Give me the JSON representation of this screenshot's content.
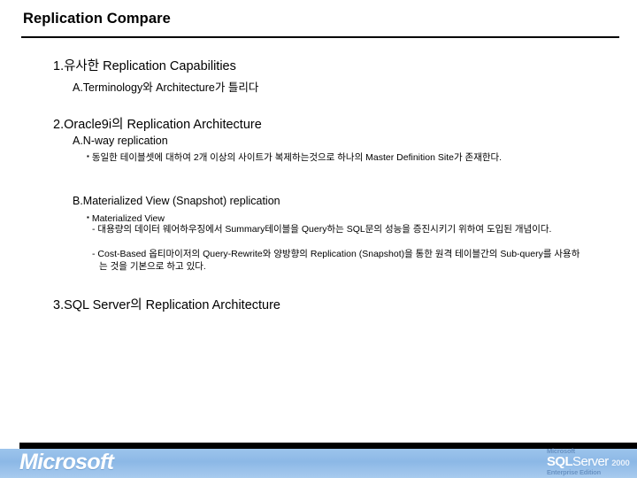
{
  "slide": {
    "title": "Replication Compare",
    "outline": [
      {
        "id": "item1",
        "text": "1.유사한 Replication Capabilities"
      },
      {
        "id": "item1a",
        "text": "A.Terminology와 Architecture가 틀리다"
      },
      {
        "id": "item2",
        "text": "2.Oracle9i의 Replication Architecture"
      },
      {
        "id": "item2a",
        "text": "A.N-way replication"
      },
      {
        "id": "item2a-bullet1",
        "text": "동일한 테이블셋에 대하여 2개 이상의 사이트가 복제하는것으로 하나의 Master Definition Site가 존재한다."
      },
      {
        "id": "item2b",
        "text": "B.Materialized View (Snapshot) replication"
      },
      {
        "id": "item2b-bullet1",
        "text": "Materialized View"
      },
      {
        "id": "item2b-dash1",
        "text": "- 대용량의 데이터 웨어하우징에서 Summary테이블을 Query하는 SQL문의 성능을 증진시키기 위하여 도입된 개념이다."
      },
      {
        "id": "item2b-dash2",
        "text": "- Cost-Based 옵티마이저의 Query-Rewrite와 양방향의 Replication (Snapshot)을 통한 원격 테이블간의 Sub-query를 사용하는 것을 기본으로 하고 있다."
      },
      {
        "id": "item3",
        "text": "3.SQL Server의 Replication Architecture"
      }
    ],
    "bullet_glyph": "▪"
  },
  "footer": {
    "microsoft_logo": "Microsoft",
    "brand_microsoft": "Microsoft",
    "brand_sql": "SQL",
    "brand_server": "Server",
    "brand_year": "2000",
    "brand_edition": "Enterprise Edition"
  },
  "colors": {
    "footer_blue": "#8cb8e6",
    "footer_bar": "#000000",
    "text": "#000000",
    "brand_text": "#5b87bb"
  }
}
